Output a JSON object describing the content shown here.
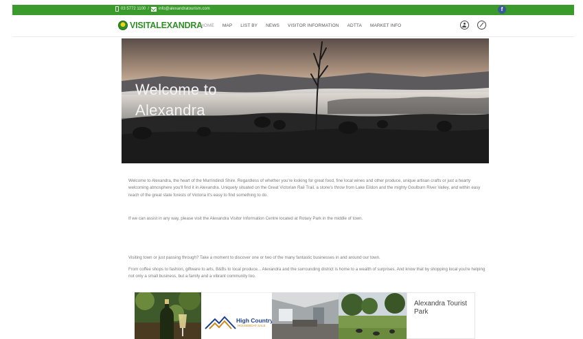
{
  "topbar": {
    "phone": "03 5772 1100",
    "separator": "/",
    "email": "info@alexandratourism.com",
    "facebook_icon": "facebook-icon",
    "color": "#3a9a2c"
  },
  "header": {
    "logo_text": "VISITALEXANDRA",
    "nav": [
      "HOME",
      "MAP",
      "LIST BY",
      "NEWS",
      "VISITOR INFORMATION",
      "ADTTA",
      "MARKET INFO"
    ],
    "active_nav": "HOME",
    "icons": [
      "user-icon",
      "compass-icon"
    ]
  },
  "hero": {
    "title": "Welcome to Alexandra"
  },
  "content": {
    "p1": "Welcome to Alexandra, the heart of the Murrindindi Shire. Regardless of whether you're looking for great food, fine local wines and other produce, unique artisan crafts or just a hearty welcoming atmosphere you'll find it in Alexandra. Uniquely situated on the Great Victorian Rail Trail, a stone's throw from Lake Eildon and the mighty Goulburn River Valley, and within easy reach of the great state forests of Victoria it's easy to find something to do.",
    "p2": "If we can assist in any way, please visit the Alexandra Visitor Information Centre located at Rotary Park in the middle of town.",
    "p3": "Visiting town or just passing through? Take a moment to discover one or two of the many fantastic businesses in and around our town.",
    "p4": "From coffee shops to fashion, giftware to arts, B&Bs to local produce... Alexandra and the surrounding district is home to a wealth of surprises. And know that by shopping local you're helping not only a small business, but a family and a vibrant community too."
  },
  "tiles": {
    "houseboat_brand": "High Country",
    "houseboat_sub": "HOUSEBOAT SALE",
    "tourist_park": "Alexandra Tourist Park"
  }
}
